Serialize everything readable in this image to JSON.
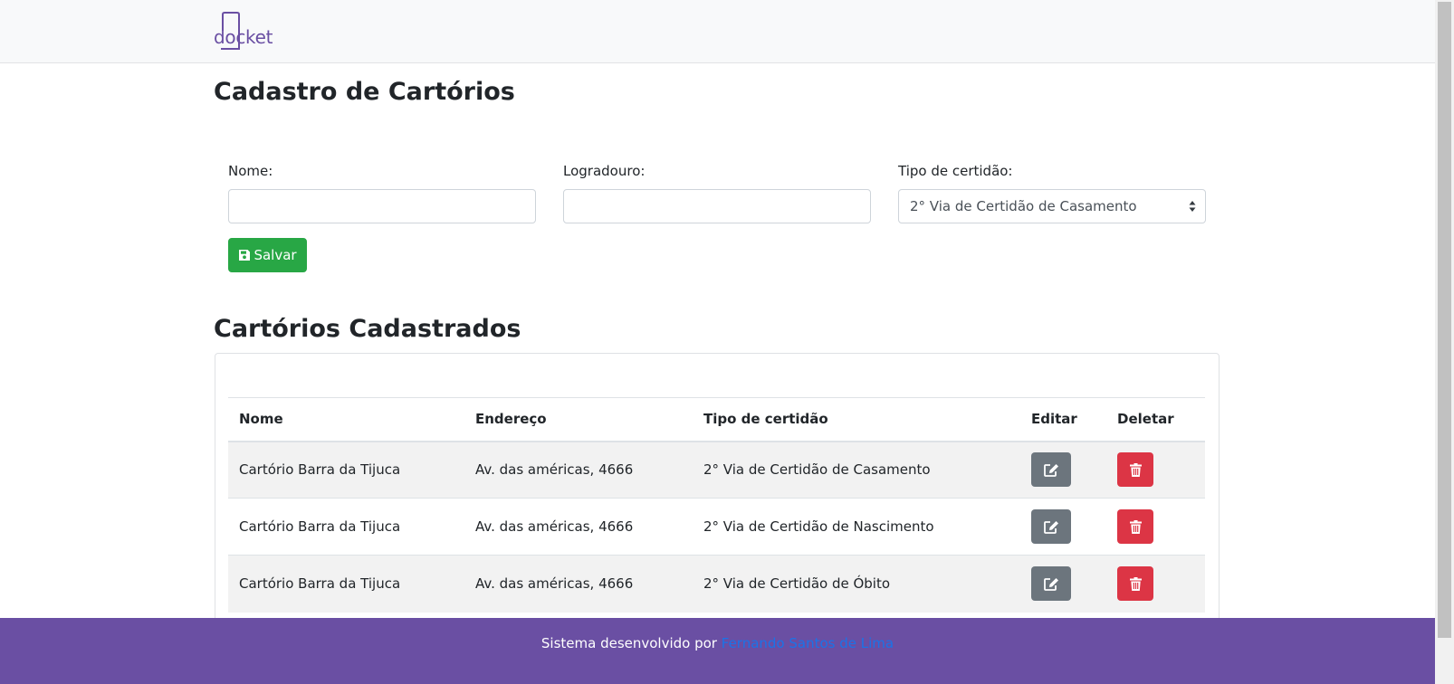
{
  "brand": {
    "logo_text": "docket",
    "accent": "#6a4fa3"
  },
  "page": {
    "title": "Cadastro de Cartórios"
  },
  "form": {
    "nome_label": "Nome:",
    "nome_value": "",
    "logradouro_label": "Logradouro:",
    "logradouro_value": "",
    "tipo_label": "Tipo de certidão:",
    "tipo_selected": "2° Via de Certidão de Casamento",
    "save_label": "Salvar",
    "save_icon": "floppy-disk-icon"
  },
  "list": {
    "title": "Cartórios Cadastrados",
    "columns": [
      "Nome",
      "Endereço",
      "Tipo de certidão",
      "Editar",
      "Deletar"
    ],
    "rows": [
      {
        "nome": "Cartório Barra da Tijuca",
        "endereco": "Av. das américas, 4666",
        "tipo": "2° Via de Certidão de Casamento"
      },
      {
        "nome": "Cartório Barra da Tijuca",
        "endereco": "Av. das américas, 4666",
        "tipo": "2° Via de Certidão de Nascimento"
      },
      {
        "nome": "Cartório Barra da Tijuca",
        "endereco": "Av. das américas, 4666",
        "tipo": "2° Via de Certidão de Óbito"
      }
    ],
    "edit_icon": "edit-icon",
    "delete_icon": "trash-icon"
  },
  "footer": {
    "text": "Sistema desenvolvido por",
    "link_text": "Fernando Santos de Lima"
  },
  "colors": {
    "save_button": "#28a745",
    "edit_button": "#6c757d",
    "delete_button": "#dc3545",
    "footer_bg": "#6a4fa3",
    "link": "#1a73e8"
  }
}
